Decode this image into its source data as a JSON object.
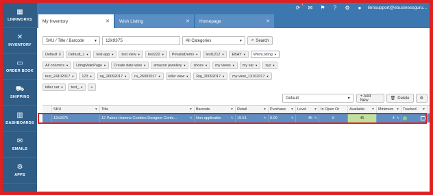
{
  "sidebar": {
    "items": [
      {
        "label": "LINNWORKS",
        "icon": "apps-grid-icon"
      },
      {
        "label": "INVENTORY",
        "icon": "tools-icon"
      },
      {
        "label": "ORDER BOOK",
        "icon": "inbox-icon"
      },
      {
        "label": "SHIPPING",
        "icon": "truck-icon"
      },
      {
        "label": "DASHBOARDS",
        "icon": "bar-chart-icon"
      },
      {
        "label": "EMAILS",
        "icon": "envelope-icon"
      },
      {
        "label": "APPS",
        "icon": "apps-icon"
      }
    ]
  },
  "topbar": {
    "user": "linnsupport@ebusinessguru...",
    "notif_badge": "1"
  },
  "tabs": [
    {
      "label": "My Inventory"
    },
    {
      "label": "Wish Listing"
    },
    {
      "label": "Homepage"
    }
  ],
  "search": {
    "field_select": "SKU / Title / Barcode",
    "query": "12k9375",
    "category": "All Categories",
    "button": "Search"
  },
  "views_row1": [
    "Default",
    "Default_1",
    "test-app",
    "test view",
    "test222",
    "PrivaliaDemo",
    "test1212",
    "EBAY",
    "WishListing"
  ],
  "views_row2": [
    "All columns",
    "LitingMainPage",
    "Create date wise",
    "amazon jewelery",
    "shoes",
    "my views",
    "my var",
    "xyz"
  ],
  "views_row3": [
    "test_24102017",
    "123",
    "raj_26092017",
    "ra_26092017",
    "killer view",
    "Raj_30092017",
    "my view_13102017"
  ],
  "views_row4": [
    "killer var",
    "test_",
    "+"
  ],
  "toolbar": {
    "view_select": "Default",
    "add_new": "+ Add New",
    "delete": "Delete"
  },
  "grid": {
    "columns": [
      "SKU",
      "Title",
      "Barcode",
      "Retail",
      "Purchase",
      "Level",
      "In Open Or",
      "Available",
      "Minimum",
      "Tracked"
    ],
    "rows": [
      {
        "sku": "12k9375",
        "title": "12 Paires Homme Culottes Designer Confo...",
        "barcode": "Non applicable",
        "retail": "19.51",
        "purchase": "0.00",
        "level": "45",
        "in_open": "6",
        "available": "45",
        "minimum": "4",
        "tracked": ""
      }
    ]
  }
}
